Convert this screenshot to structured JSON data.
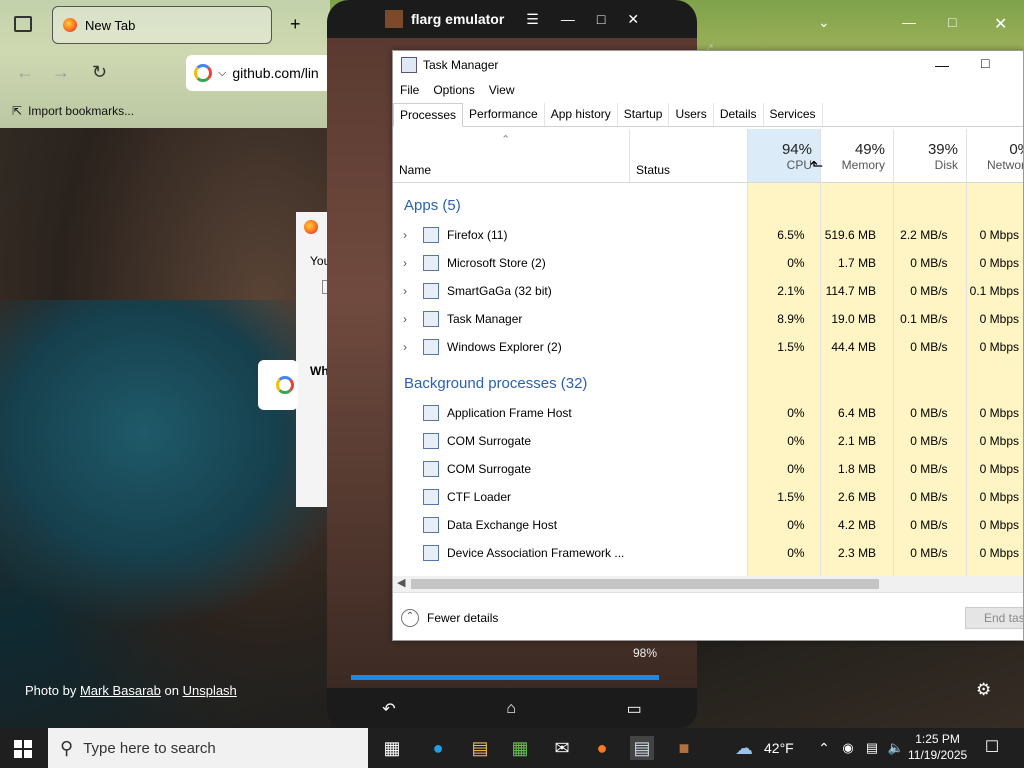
{
  "browser": {
    "tab_title": "New Tab",
    "url": "github.com/lin",
    "bookmark": "Import bookmarks..."
  },
  "desktop": {
    "photo_by": "Photo by",
    "author": "Mark Basarab",
    "on": "on",
    "site": "Unsplash",
    "dialog_frag1": "You",
    "dialog_frag2": "Wh"
  },
  "emulator": {
    "title": "flarg emulator",
    "progress_label": "98%",
    "progress": 0.98
  },
  "taskmanager": {
    "title": "Task Manager",
    "menu": [
      "File",
      "Options",
      "View"
    ],
    "tabs": [
      "Processes",
      "Performance",
      "App history",
      "Startup",
      "Users",
      "Details",
      "Services"
    ],
    "headers": {
      "name": "Name",
      "status": "Status",
      "cpu_pct": "94%",
      "cpu": "CPU",
      "mem_pct": "49%",
      "mem": "Memory",
      "disk_pct": "39%",
      "disk": "Disk",
      "net_pct": "0%",
      "net": "Network"
    },
    "apps_group": "Apps (5)",
    "apps": [
      {
        "name": "Firefox (11)",
        "cpu": "6.5%",
        "mem": "519.6 MB",
        "disk": "2.2 MB/s",
        "net": "0 Mbps"
      },
      {
        "name": "Microsoft Store (2)",
        "cpu": "0%",
        "mem": "1.7 MB",
        "disk": "0 MB/s",
        "net": "0 Mbps"
      },
      {
        "name": "SmartGaGa (32 bit)",
        "cpu": "2.1%",
        "mem": "114.7 MB",
        "disk": "0 MB/s",
        "net": "0.1 Mbps"
      },
      {
        "name": "Task Manager",
        "cpu": "8.9%",
        "mem": "19.0 MB",
        "disk": "0.1 MB/s",
        "net": "0 Mbps"
      },
      {
        "name": "Windows Explorer (2)",
        "cpu": "1.5%",
        "mem": "44.4 MB",
        "disk": "0 MB/s",
        "net": "0 Mbps"
      }
    ],
    "bg_group": "Background processes (32)",
    "background": [
      {
        "name": "Application Frame Host",
        "cpu": "0%",
        "mem": "6.4 MB",
        "disk": "0 MB/s",
        "net": "0 Mbps"
      },
      {
        "name": "COM Surrogate",
        "cpu": "0%",
        "mem": "2.1 MB",
        "disk": "0 MB/s",
        "net": "0 Mbps"
      },
      {
        "name": "COM Surrogate",
        "cpu": "0%",
        "mem": "1.8 MB",
        "disk": "0 MB/s",
        "net": "0 Mbps"
      },
      {
        "name": "CTF Loader",
        "cpu": "1.5%",
        "mem": "2.6 MB",
        "disk": "0 MB/s",
        "net": "0 Mbps"
      },
      {
        "name": "Data Exchange Host",
        "cpu": "0%",
        "mem": "4.2 MB",
        "disk": "0 MB/s",
        "net": "0 Mbps"
      },
      {
        "name": "Device Association Framework ...",
        "cpu": "0%",
        "mem": "2.3 MB",
        "disk": "0 MB/s",
        "net": "0 Mbps"
      }
    ],
    "fewer_details": "Fewer details",
    "end_task": "End task"
  },
  "taskbar": {
    "search_placeholder": "Type here to search",
    "weather": "42°F",
    "time": "1:25 PM",
    "date": "11/19/2025"
  }
}
